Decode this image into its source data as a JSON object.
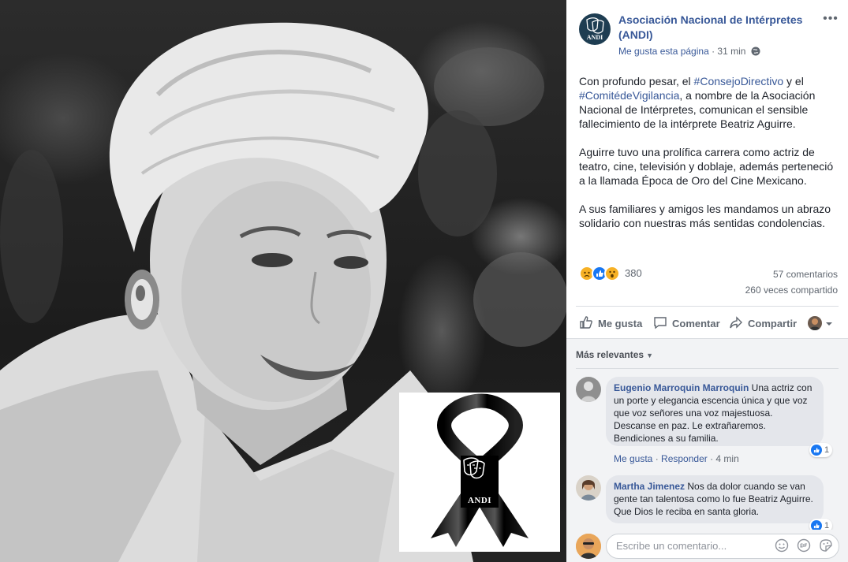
{
  "photo": {
    "mourning_card": {
      "badge_text": "ANDI"
    }
  },
  "post": {
    "page_name": "Asociación Nacional de Intérpretes (ANDI)",
    "avatar_text": "ANDI",
    "meta_like_page": "Me gusta esta página",
    "meta_separator": " · ",
    "timestamp": "31 min",
    "privacy_icon": "globe-icon",
    "more_options_icon": "more-options-icon",
    "paragraph_1_a": "Con profundo pesar, el ",
    "hashtag_1": "#ConsejoDirectivo",
    "paragraph_1_b": " y el ",
    "hashtag_2": "#ComitédeVigilancia",
    "paragraph_1_c": ", a nombre de la Asociación Nacional de Intérpretes, comunican el sensible fallecimiento de la intérprete Beatriz Aguirre.",
    "paragraph_2": "Aguirre tuvo una prolífica carrera como actriz de teatro, cine, televisión y doblaje, además perteneció a la llamada Época de Oro del Cine Mexicano.",
    "paragraph_3": "A sus familiares y amigos les mandamos un abrazo solidario con nuestras más sentidas condolencias.",
    "reactions": {
      "icons": [
        "sad-reaction-icon",
        "like-reaction-icon",
        "wow-reaction-icon"
      ],
      "count": "380"
    },
    "comments_count": "57 comentarios",
    "shares_count": "260 veces compartido",
    "actions": {
      "like": "Me gusta",
      "comment": "Comentar",
      "share": "Compartir"
    }
  },
  "comments": {
    "sort_label": "Más relevantes",
    "items": [
      {
        "author": "Eugenio Marroquin Marroquin",
        "text": "Una actriz con un porte y elegancia escencia única y que voz que voz señores una voz majestuosa. Descanse en paz. Le extrañaremos. Bendiciones a su familia.",
        "like_link": "Me gusta",
        "reply_link": "Responder",
        "time": "4 min",
        "likes": "1"
      },
      {
        "author": "Martha Jimenez",
        "text": "Nos da dolor cuando se van gente tan talentosa como lo fue Beatriz Aguirre. Que Dios le reciba en santa gloria.",
        "likes": "1"
      }
    ],
    "composer_placeholder": "Escribe un comentario..."
  },
  "colors": {
    "link_blue": "#385898",
    "text_primary": "#1d2129",
    "text_secondary": "#606770",
    "like_blue": "#1877f2",
    "comment_bubble": "#e4e6eb",
    "comments_bg": "#f2f3f5"
  }
}
